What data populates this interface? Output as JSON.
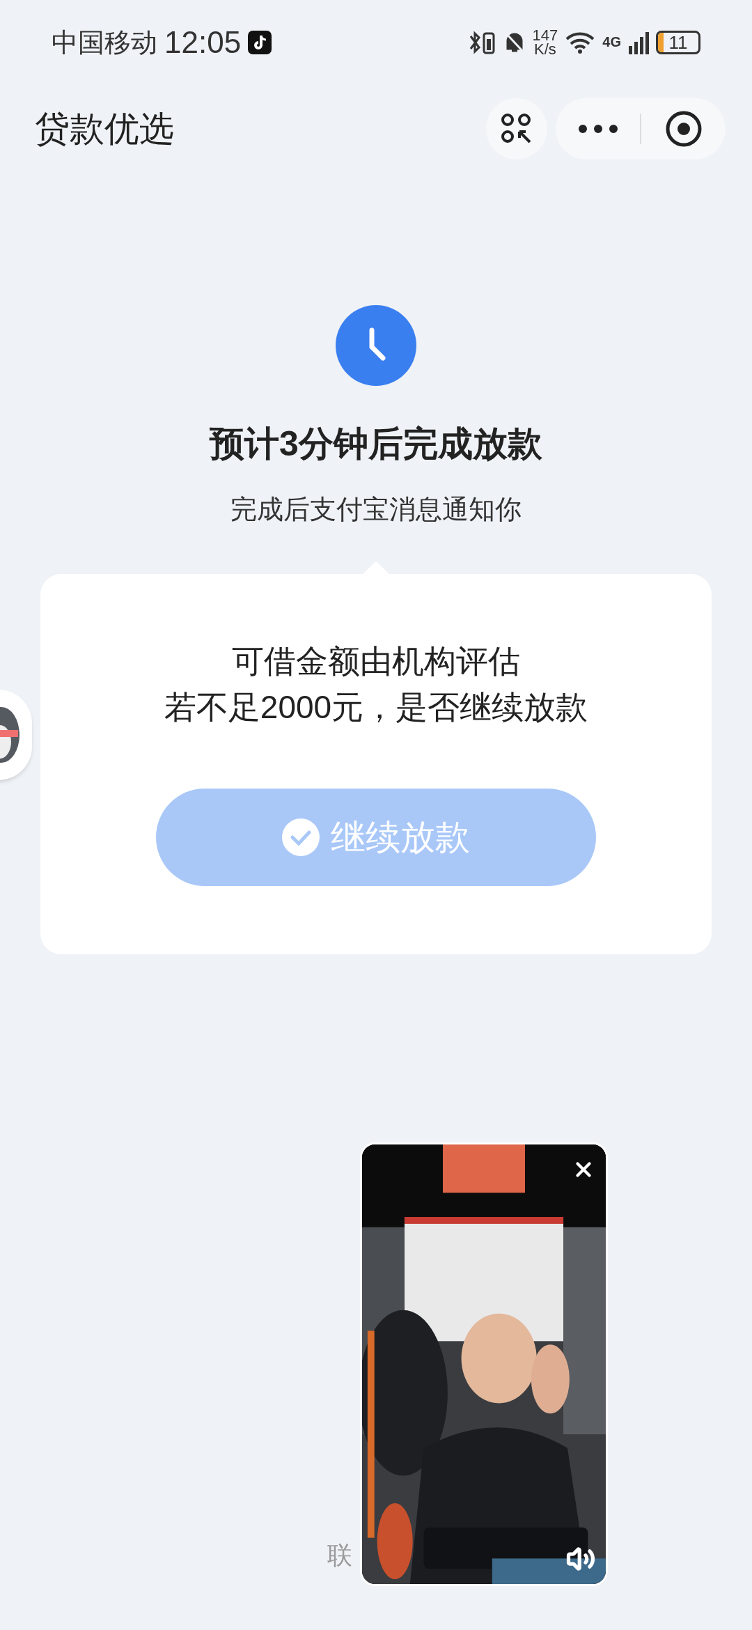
{
  "status_bar": {
    "carrier": "中国移动",
    "time": "12:05",
    "speed_value": "147",
    "speed_unit": "K/s",
    "network": "4G",
    "battery": "11"
  },
  "nav": {
    "title": "贷款优选"
  },
  "result": {
    "heading": "预计3分钟后完成放款",
    "subtitle": "完成后支付宝消息通知你"
  },
  "card": {
    "lines": [
      "可借金额由机构评估",
      "若不足2000元，是否继续放款"
    ],
    "button": {
      "label": "继续放款",
      "disabled": true
    }
  },
  "footer": {
    "text": "联"
  }
}
